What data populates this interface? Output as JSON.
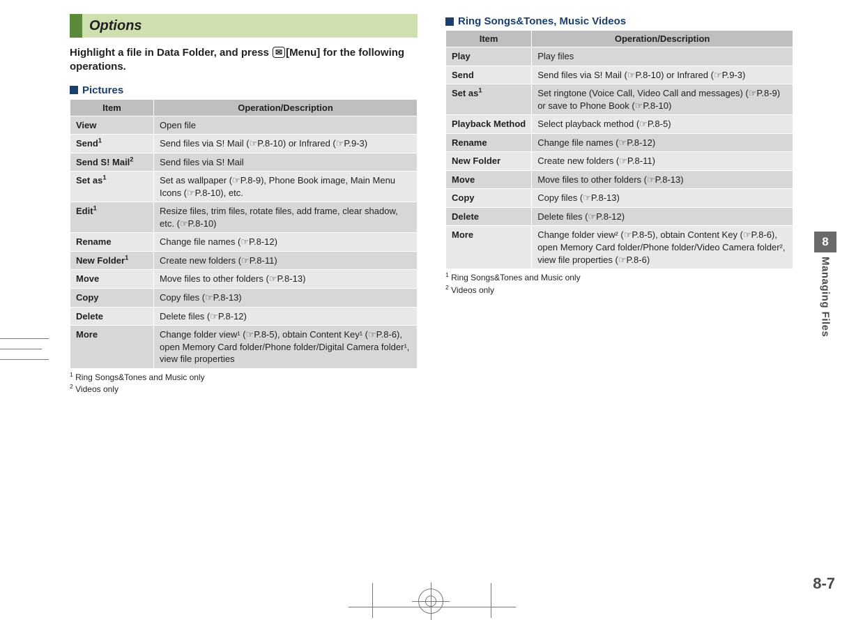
{
  "section_title": "Options",
  "intro_part1": "Highlight a file in Data Folder, and press ",
  "intro_key": "✉",
  "intro_part2": "[Menu] for the following operations.",
  "left": {
    "heading": "Pictures",
    "table_head_item": "Item",
    "table_head_desc": "Operation/Description",
    "rows": [
      {
        "item": "View",
        "sup": "",
        "desc": "Open file"
      },
      {
        "item": "Send",
        "sup": "1",
        "desc": "Send files via S! Mail (☞P.8-10) or Infrared (☞P.9-3)"
      },
      {
        "item": "Send S! Mail",
        "sup": "2",
        "desc": "Send files via S! Mail"
      },
      {
        "item": "Set as",
        "sup": "1",
        "desc": "Set as wallpaper (☞P.8-9), Phone Book image, Main Menu Icons (☞P.8-10), etc."
      },
      {
        "item": "Edit",
        "sup": "1",
        "desc": "Resize files, trim files, rotate files, add frame, clear shadow, etc. (☞P.8-10)"
      },
      {
        "item": "Rename",
        "sup": "",
        "desc": "Change file names (☞P.8-12)"
      },
      {
        "item": "New Folder",
        "sup": "1",
        "desc": "Create new folders (☞P.8-11)"
      },
      {
        "item": "Move",
        "sup": "",
        "desc": "Move files to other folders (☞P.8-13)"
      },
      {
        "item": "Copy",
        "sup": "",
        "desc": "Copy files (☞P.8-13)"
      },
      {
        "item": "Delete",
        "sup": "",
        "desc": "Delete files (☞P.8-12)"
      },
      {
        "item": "More",
        "sup": "",
        "desc": "Change folder view¹ (☞P.8-5), obtain Content Key¹ (☞P.8-6), open Memory Card folder/Phone folder/Digital Camera folder¹, view file properties"
      }
    ],
    "footnote1": "Ring Songs&Tones and Music only",
    "footnote2": "Videos only"
  },
  "right": {
    "heading": "Ring Songs&Tones, Music Videos",
    "table_head_item": "Item",
    "table_head_desc": "Operation/Description",
    "rows": [
      {
        "item": "Play",
        "sup": "",
        "desc": "Play files"
      },
      {
        "item": "Send",
        "sup": "",
        "desc": "Send files via S! Mail (☞P.8-10) or Infrared (☞P.9-3)"
      },
      {
        "item": "Set as",
        "sup": "1",
        "desc": "Set ringtone (Voice Call, Video Call and messages) (☞P.8-9) or save to Phone Book (☞P.8-10)"
      },
      {
        "item": "Playback Method",
        "sup": "",
        "desc": "Select playback method (☞P.8-5)"
      },
      {
        "item": "Rename",
        "sup": "",
        "desc": "Change file names (☞P.8-12)"
      },
      {
        "item": "New Folder",
        "sup": "",
        "desc": "Create new folders (☞P.8-11)"
      },
      {
        "item": "Move",
        "sup": "",
        "desc": "Move files to other folders (☞P.8-13)"
      },
      {
        "item": "Copy",
        "sup": "",
        "desc": "Copy files (☞P.8-13)"
      },
      {
        "item": "Delete",
        "sup": "",
        "desc": "Delete files (☞P.8-12)"
      },
      {
        "item": "More",
        "sup": "",
        "desc": "Change folder view² (☞P.8-5), obtain Content Key (☞P.8-6), open Memory Card folder/Phone folder/Video Camera folder², view file properties (☞P.8-6)"
      }
    ],
    "footnote1": "Ring Songs&Tones and Music only",
    "footnote2": "Videos only"
  },
  "side": {
    "chapter_num": "8",
    "chapter_name": "Managing Files"
  },
  "page_number": "8-7"
}
